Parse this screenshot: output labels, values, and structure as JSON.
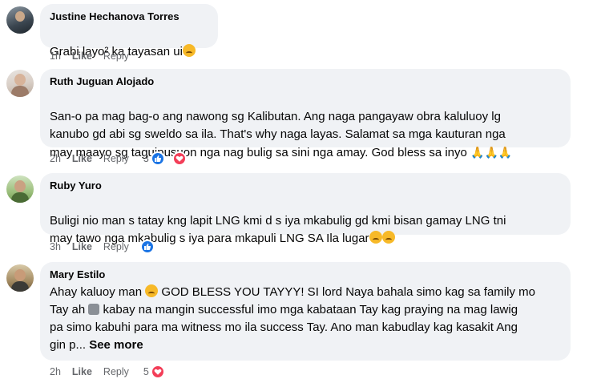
{
  "comments": [
    {
      "author": "Justine Hechanova Torres",
      "text": "Grabi layo² ka tayasan ui",
      "time": "1h",
      "like": "Like",
      "reply": "Reply",
      "reaction_count": ""
    },
    {
      "author": "Ruth Juguan Alojado",
      "text": "San-o pa mag bag-o ang nawong sg Kalibutan. Ang naga pangayaw obra kaluluoy lg\nkanubo gd abi sg sweldo sa ila. That's why naga layas. Salamat sa mga kauturan nga\nmay maayo sg taguipusuon nga nag bulig sa sini nga amay. God bless sa inyo",
      "time": "2h",
      "like": "Like",
      "reply": "Reply",
      "reaction_count": "3"
    },
    {
      "author": "Ruby Yuro",
      "text": "Buligi nio man s tatay kng lapit LNG kmi d s iya mkabulig gd kmi bisan gamay LNG tni\nmay tawo nga mkabulig s iya para mkapuli LNG SA Ila lugar",
      "time": "3h",
      "like": "Like",
      "reply": "Reply",
      "reaction_count": ""
    },
    {
      "author": "Mary Estilo",
      "text_1": "Ahay kaluoy man ",
      "text_2": " GOD BLESS YOU TAYYY! SI lord Naya bahala simo kag sa family mo",
      "text_3": "Tay ah ",
      "text_4": " kabay na mangin successful imo mga kabataan Tay kag praying na mag lawig\npa simo kabuhi para ma witness mo ila success Tay. Ano man kabudlay kag kasakit Ang\ngin p... ",
      "see_more": "See more",
      "time": "2h",
      "like": "Like",
      "reply": "Reply",
      "reaction_count": "5"
    }
  ],
  "colors": {
    "bubble": "#f0f2f5",
    "meta": "#65676b",
    "like_blue": "#1b74e4",
    "love_red": "#f33e58"
  },
  "icons": [
    "avatar",
    "like-reaction-icon",
    "love-reaction-icon",
    "emoji-sad-icon",
    "praying-hands-icon"
  ]
}
